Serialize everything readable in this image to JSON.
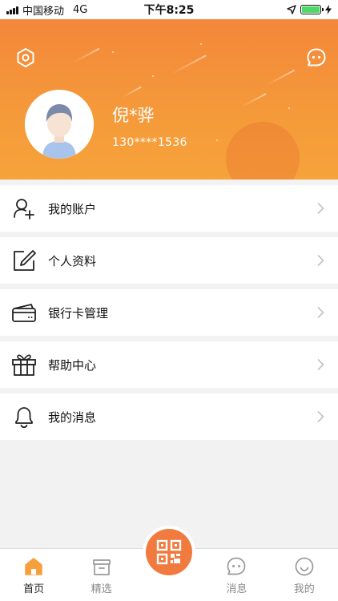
{
  "status_bar": {
    "carrier": "中国移动",
    "network": "4G",
    "time": "下午8:25"
  },
  "header": {
    "user_name": "倪*骅",
    "phone": "130****1536"
  },
  "menu": {
    "items": [
      {
        "label": "我的账户",
        "icon": "user-add-icon"
      },
      {
        "label": "个人资料",
        "icon": "edit-icon"
      },
      {
        "label": "银行卡管理",
        "icon": "bank-card-icon"
      },
      {
        "label": "帮助中心",
        "icon": "gift-icon"
      },
      {
        "label": "我的消息",
        "icon": "bell-icon"
      }
    ]
  },
  "tabbar": {
    "tabs": [
      {
        "label": "首页",
        "icon": "home-icon"
      },
      {
        "label": "精选",
        "icon": "store-icon"
      },
      {
        "label": "",
        "icon": "qr-scan-icon"
      },
      {
        "label": "消息",
        "icon": "chat-icon"
      },
      {
        "label": "我的",
        "icon": "smile-icon"
      }
    ],
    "active_tab": 0
  },
  "colors": {
    "accent": "#f17a3f",
    "header_top": "#f3873a",
    "header_bottom": "#f6a33b",
    "battery": "#4cd964"
  }
}
